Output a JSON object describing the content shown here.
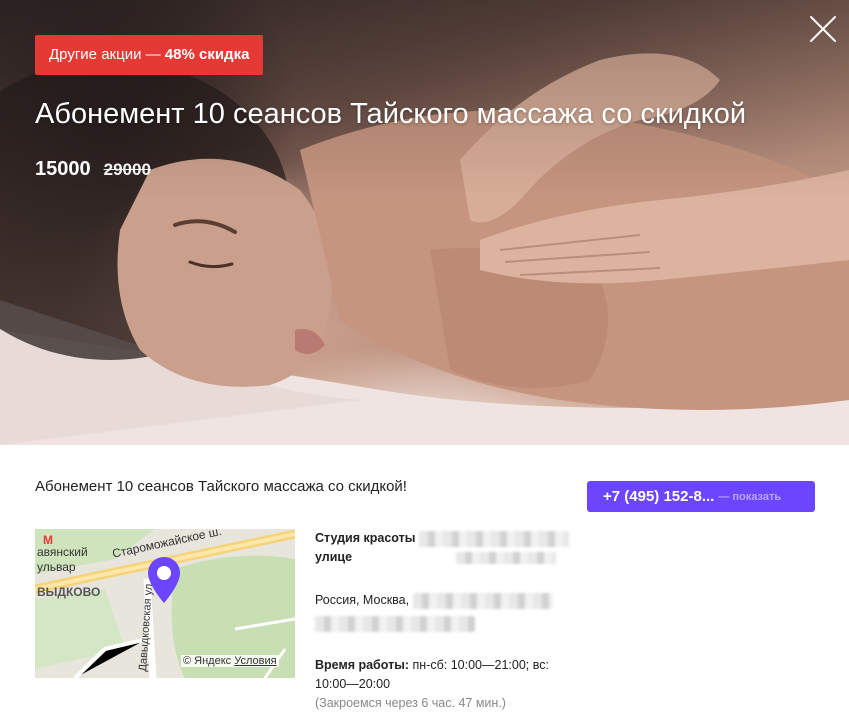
{
  "promo": {
    "prefix": "Другие акции — ",
    "discount": "48% скидка"
  },
  "title": "Абонемент 10 сеансов Тайского массажа со скидкой",
  "price": {
    "new": "15000",
    "old": "29000"
  },
  "description": "Абонемент 10 сеансов Тайского массажа со скидкой!",
  "phone": {
    "number": "+7 (495) 152-8...",
    "show_label": "— показать"
  },
  "map": {
    "labels": {
      "street1": "Староможайское ш.",
      "street2": "Давыдковская ул.",
      "district": "ВЫДКОВО",
      "boulevard1": "авянский",
      "boulevard2": "ульвар",
      "metro": "М"
    },
    "attribution": "© Яндекс",
    "terms_link": "Условия",
    "accent_color": "#6c45ff"
  },
  "info": {
    "studio_prefix": "Студия красоты",
    "studio_suffix": "улице",
    "address_prefix": "Россия, Москва,",
    "hours_label": "Время работы:",
    "hours_value": " пн-сб: 10:00—21:00; вс: 10:00—20:00",
    "closing_note": "(Закроемся через 6 час. 47 мин.)"
  },
  "colors": {
    "badge": "#e53935",
    "button": "#6c45ff"
  },
  "icons": {
    "close": "close-icon",
    "pin": "map-pin-icon"
  }
}
